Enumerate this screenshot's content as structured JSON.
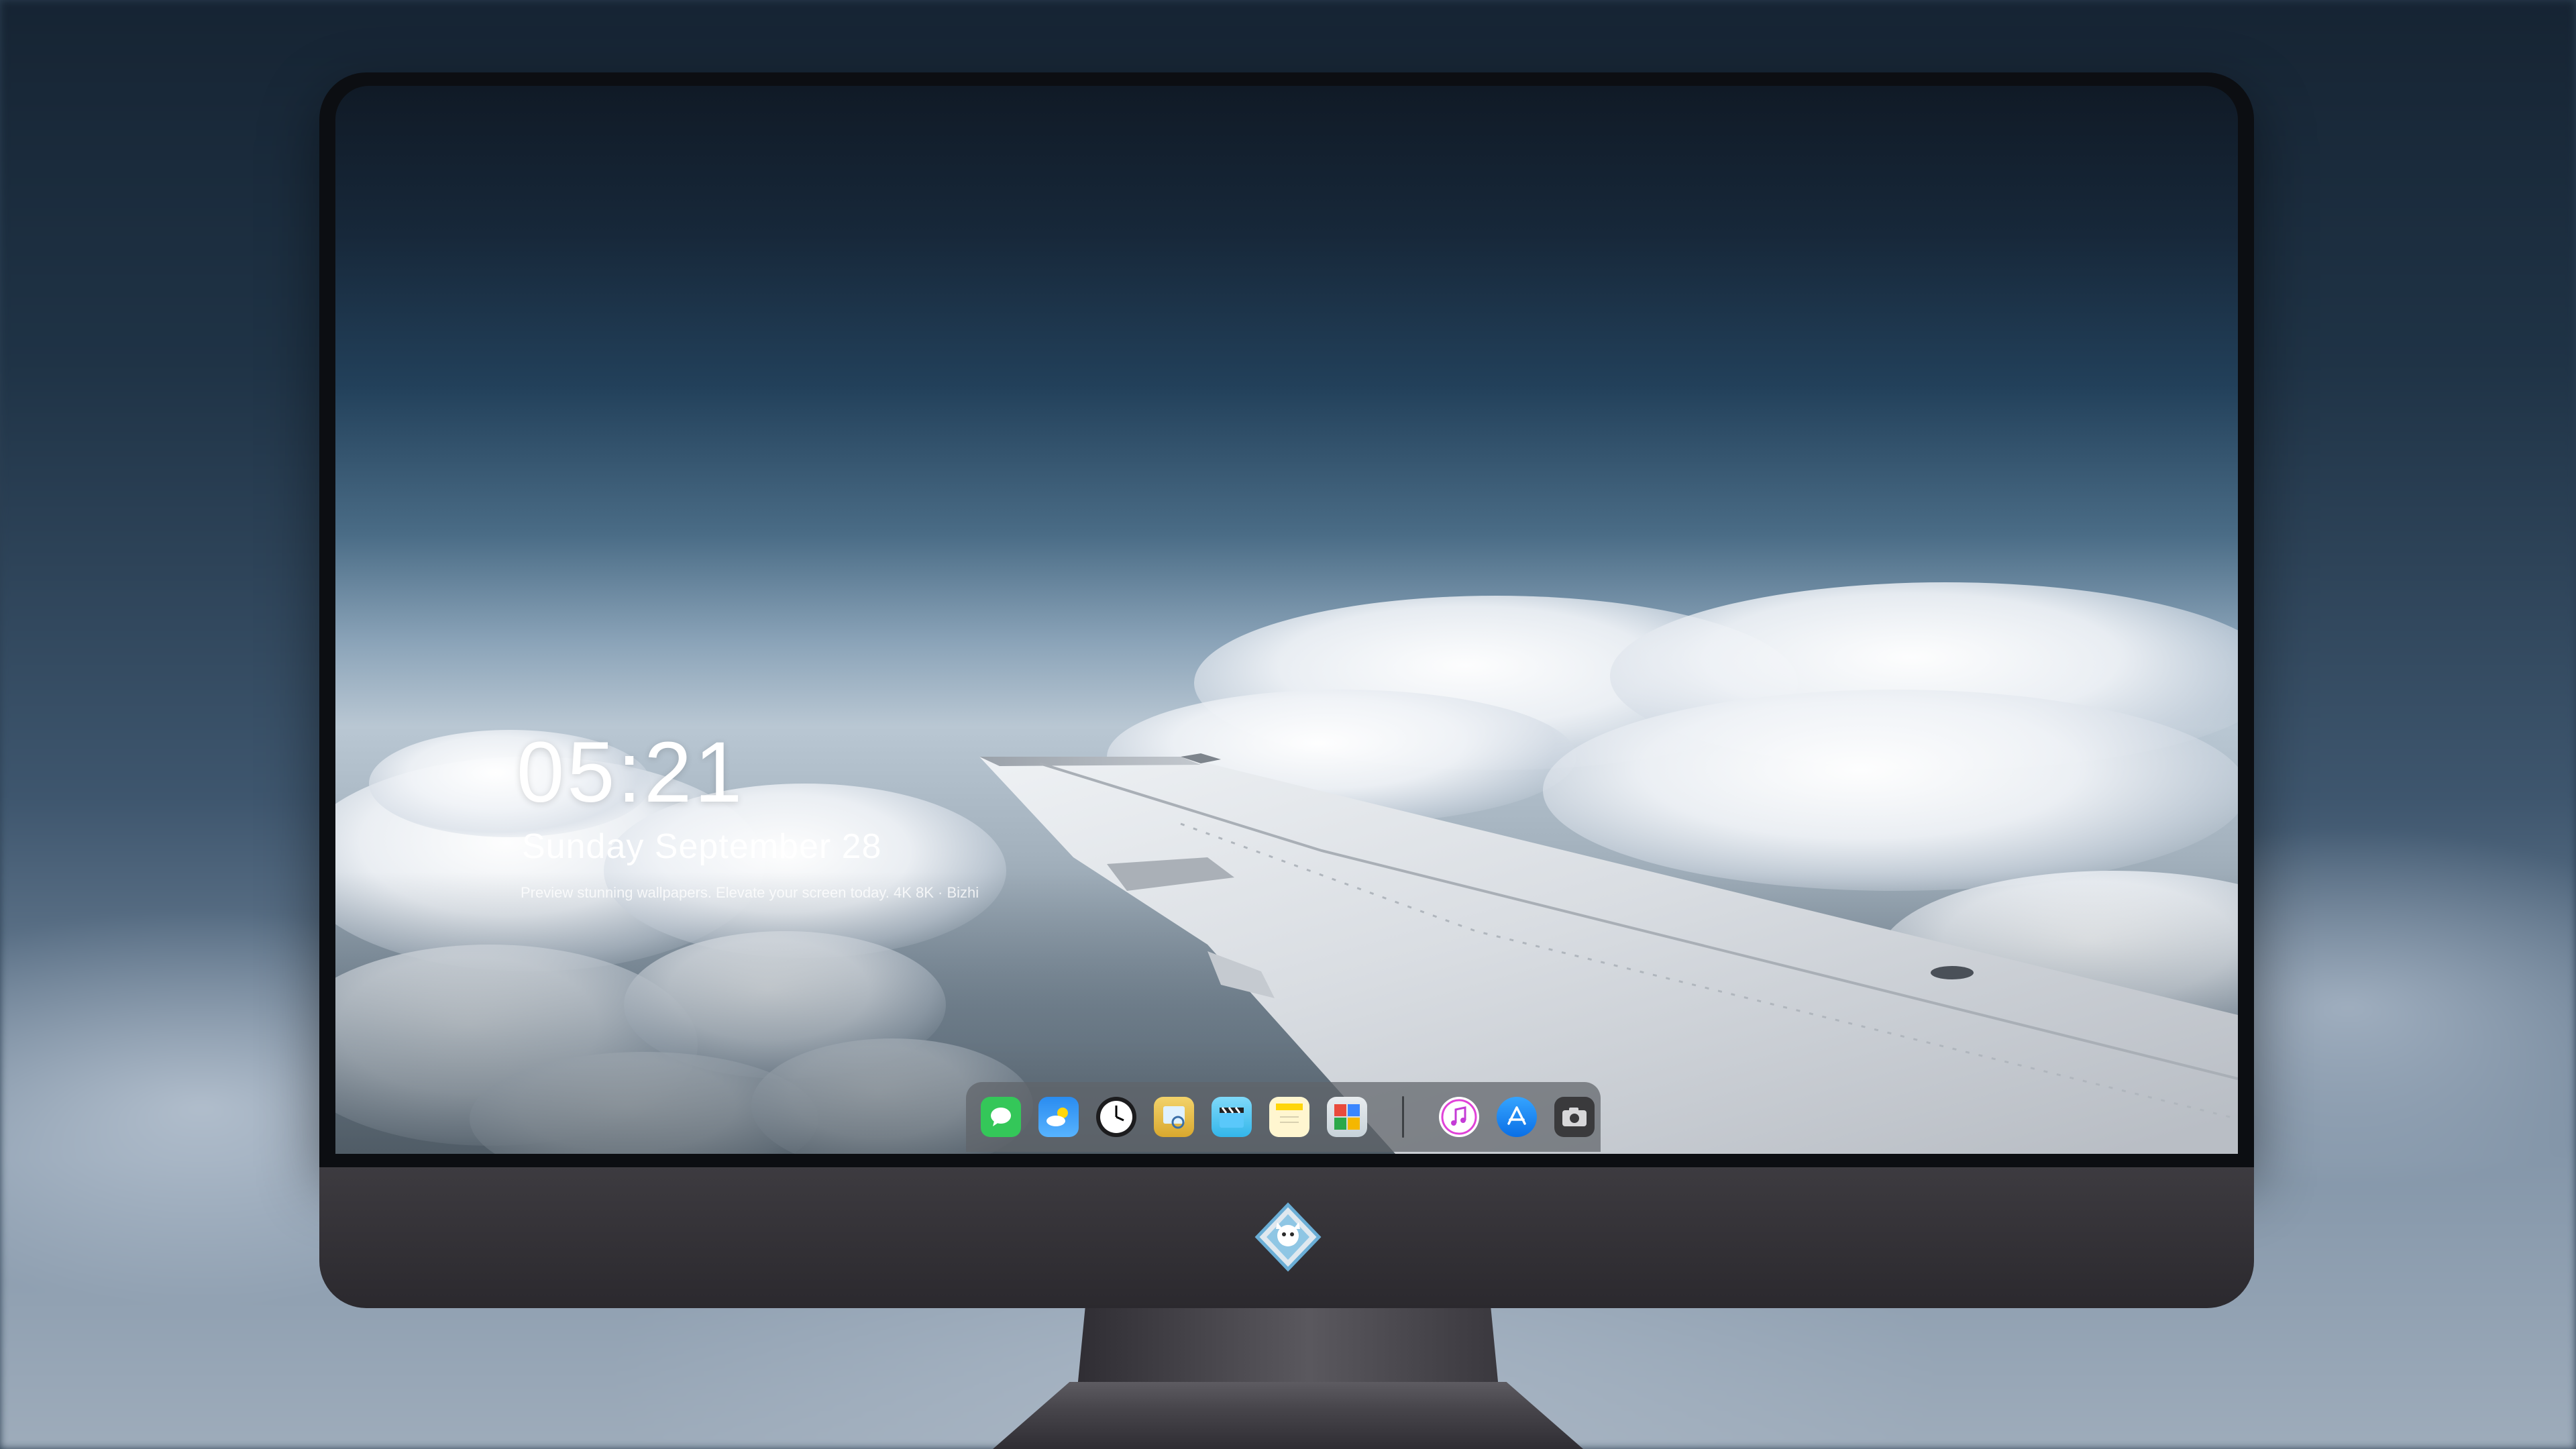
{
  "lock_screen": {
    "time": "05:21",
    "date": "Sunday September  28",
    "tagline": "Preview stunning wallpapers. Elevate your screen today. 4K 8K · Bizhi"
  },
  "dock": {
    "apps": [
      {
        "name": "messages-icon",
        "color": "#34c759"
      },
      {
        "name": "weather-icon",
        "color": "#1e90ff"
      },
      {
        "name": "clock-icon",
        "color": "#1c1c1e"
      },
      {
        "name": "preview-icon",
        "color": "#e6c34a"
      },
      {
        "name": "clips-icon",
        "color": "#5ac8fa"
      },
      {
        "name": "notes-icon",
        "color": "#ffd60a"
      },
      {
        "name": "photo-booth-icon",
        "color": "#2ba84a"
      },
      {
        "name": "music-icon",
        "color": "#e042d8"
      },
      {
        "name": "app-store-icon",
        "color": "#0a84ff"
      },
      {
        "name": "camera-icon",
        "color": "#3a3a3c"
      }
    ]
  },
  "monitor": {
    "chin_logo": "mascot-logo-icon"
  }
}
